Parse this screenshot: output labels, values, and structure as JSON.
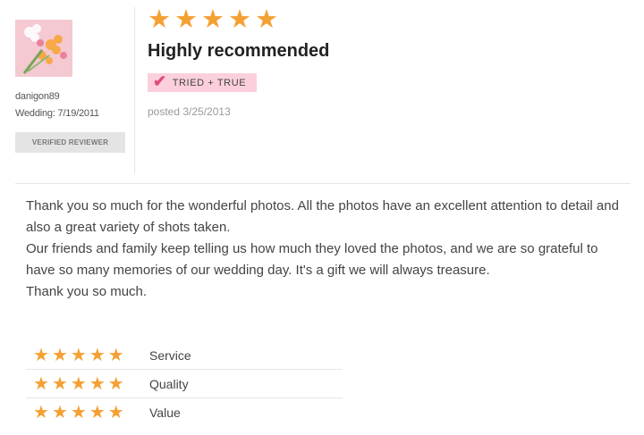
{
  "reviewer": {
    "username": "danigon89",
    "wedding": "Wedding: 7/19/2011",
    "verified_label": "VERIFIED REVIEWER"
  },
  "review": {
    "rating": 5,
    "rating_max": 5,
    "title": "Highly recommended",
    "badge_label": "TRIED + TRUE",
    "posted": "posted 3/25/2013",
    "body": [
      "Thank you so much for the wonderful photos. All the photos have an excellent attention to detail and also a great variety of shots taken.",
      "Our friends and family keep telling us how much they loved the photos, and we are so grateful to have so many memories of our wedding day. It's a gift we will always treasure.",
      "Thank you so much."
    ]
  },
  "ratings": [
    {
      "label": "Service",
      "stars": 5
    },
    {
      "label": "Quality",
      "stars": 5
    },
    {
      "label": "Value",
      "stars": 5
    }
  ],
  "colors": {
    "star": "#f5a033",
    "badge_bg": "#fbd0dc",
    "badge_check": "#e24a79",
    "verified_bg": "#e4e4e4"
  },
  "icons": {
    "star": "star-icon",
    "check": "checkmark-icon"
  }
}
